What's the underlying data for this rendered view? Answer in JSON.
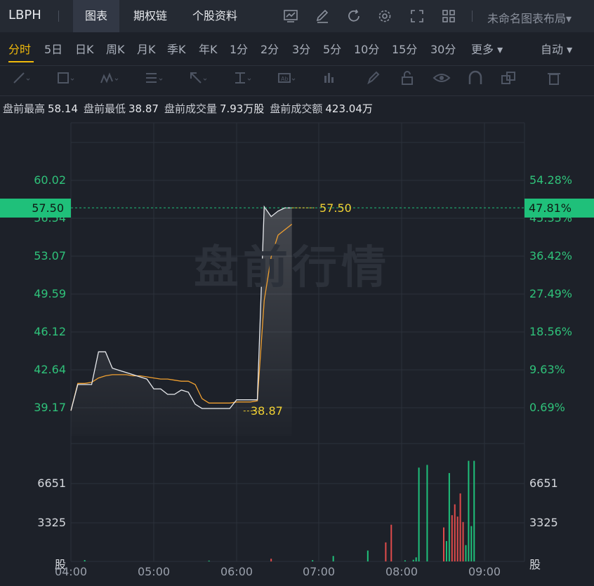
{
  "topbar": {
    "ticker": "LBPH",
    "tabs": [
      "图表",
      "期权链",
      "个股资料"
    ],
    "icons": [
      "chart-settings-icon",
      "edit-icon",
      "refresh-icon",
      "gear-icon",
      "fullscreen-icon",
      "grid-layout-icon"
    ],
    "layout_name": "未命名图表布局▾"
  },
  "periods": [
    "分时",
    "5日",
    "日K",
    "周K",
    "月K",
    "季K",
    "年K",
    "1分",
    "2分",
    "3分",
    "5分",
    "10分",
    "15分",
    "30分",
    "更多 ▾"
  ],
  "auto_label": "自动 ▾",
  "draw_tools": [
    "line-tool-icon",
    "rectangle-tool-icon",
    "pattern-tool-icon",
    "fib-tool-icon",
    "arrow-tool-icon",
    "measure-tool-icon",
    "text-tool-icon",
    "bars-tool-icon",
    "pencil-icon",
    "lock-icon",
    "eye-icon",
    "magnet-icon",
    "copy-icon",
    "trash-icon"
  ],
  "info": {
    "pre_high_label": "盘前最高",
    "pre_high": "58.14",
    "pre_low_label": "盘前最低",
    "pre_low": "38.87",
    "pre_vol_label": "盘前成交量",
    "pre_vol": "7.93万股",
    "pre_amt_label": "盘前成交额",
    "pre_amt": "423.04万"
  },
  "watermark": "盘前行情",
  "current_price": "57.50",
  "current_pct": "47.81%",
  "price_axis_left": [
    "60.02",
    "56.54",
    "53.07",
    "49.59",
    "46.12",
    "42.64",
    "39.17"
  ],
  "price_axis_right": [
    "54.28%",
    "45.35%",
    "36.42%",
    "27.49%",
    "18.56%",
    "9.63%",
    "0.69%"
  ],
  "volume_axis_left": [
    "6651",
    "3325",
    "股"
  ],
  "volume_axis_right": [
    "6651",
    "3325",
    "股"
  ],
  "time_axis": [
    "04:00",
    "05:00",
    "06:00",
    "07:00",
    "08:00",
    "09:00"
  ],
  "markers": {
    "high": "57.50",
    "low": "38.87"
  },
  "colors": {
    "up": "#e04b4b",
    "down": "#1fc07a",
    "avg_line": "#f0a030",
    "price_line": "#e8eaee",
    "accent": "#f0b90b"
  },
  "chart_data": {
    "type": "line",
    "title": "",
    "x": [
      "04:00",
      "04:05",
      "04:10",
      "04:15",
      "04:20",
      "04:25",
      "04:30",
      "04:35",
      "04:40",
      "04:45",
      "04:50",
      "04:55",
      "05:00",
      "05:05",
      "05:10",
      "05:15",
      "05:20",
      "05:25",
      "05:30",
      "05:35",
      "05:40",
      "05:45",
      "05:50",
      "05:55",
      "06:00",
      "06:05",
      "06:10",
      "06:15",
      "06:20",
      "06:25",
      "06:30",
      "06:35",
      "06:40"
    ],
    "series": [
      {
        "name": "price",
        "values": [
          38.9,
          41.3,
          41.3,
          41.3,
          44.3,
          44.3,
          42.8,
          42.6,
          42.4,
          42.2,
          42.0,
          41.8,
          40.9,
          40.9,
          40.4,
          40.4,
          40.8,
          40.6,
          39.5,
          39.1,
          39.1,
          39.1,
          39.1,
          39.1,
          39.9,
          39.9,
          39.9,
          39.9,
          57.6,
          56.7,
          57.2,
          57.5,
          57.5
        ]
      },
      {
        "name": "avg",
        "values": [
          38.9,
          41.4,
          41.4,
          41.5,
          41.9,
          42.1,
          42.2,
          42.2,
          42.2,
          42.1,
          42.1,
          42.0,
          41.9,
          41.8,
          41.8,
          41.7,
          41.6,
          41.6,
          41.3,
          40.0,
          39.6,
          39.6,
          39.6,
          39.6,
          39.7,
          39.7,
          39.7,
          39.8,
          49.0,
          53.0,
          55.0,
          55.5,
          56.0
        ]
      }
    ],
    "ylim": [
      39.17,
      60.02
    ],
    "volume": {
      "ylim": [
        0,
        8000
      ],
      "x_minutes": [
        10,
        100,
        145,
        175,
        190,
        215,
        228,
        232,
        242,
        248,
        250,
        252,
        258,
        270,
        272,
        274,
        276,
        278,
        280,
        282,
        284,
        286,
        288,
        290,
        292
      ],
      "values": [
        100,
        60,
        200,
        90,
        400,
        800,
        1400,
        2700,
        80,
        120,
        300,
        6900,
        7100,
        2500,
        1500,
        6500,
        3400,
        4200,
        3300,
        5000,
        2900,
        1200,
        7400,
        2600,
        7400
      ],
      "colors": [
        "g",
        "g",
        "r",
        "g",
        "g",
        "g",
        "r",
        "r",
        "g",
        "g",
        "g",
        "g",
        "g",
        "r",
        "g",
        "g",
        "r",
        "r",
        "r",
        "r",
        "r",
        "g",
        "g",
        "g",
        "g"
      ]
    }
  }
}
